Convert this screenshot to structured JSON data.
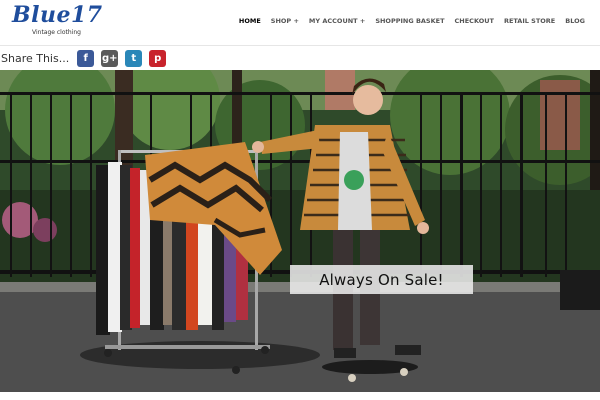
{
  "header": {
    "logo_text": "Blue17",
    "logo_subtitle": "Vintage clothing"
  },
  "nav": {
    "items": [
      {
        "label": "HOME"
      },
      {
        "label": "SHOP +"
      },
      {
        "label": "MY ACCOUNT +"
      },
      {
        "label": "SHOPPING BASKET"
      },
      {
        "label": "CHECKOUT"
      },
      {
        "label": "RETAIL STORE"
      },
      {
        "label": "BLOG"
      }
    ]
  },
  "share": {
    "label": "Share This...",
    "buttons": [
      {
        "icon": "facebook-icon",
        "glyph": "f",
        "color": "#3b5998"
      },
      {
        "icon": "google-plus-icon",
        "glyph": "g+",
        "color": "#5a5a5a"
      },
      {
        "icon": "twitter-icon",
        "glyph": "t",
        "color": "#2a87b8"
      },
      {
        "icon": "pinterest-icon",
        "glyph": "p",
        "color": "#c8232c"
      }
    ]
  },
  "hero": {
    "caption": "Always On Sale!"
  },
  "colors": {
    "brand": "#1f4d9c",
    "nav_text": "#555555"
  }
}
